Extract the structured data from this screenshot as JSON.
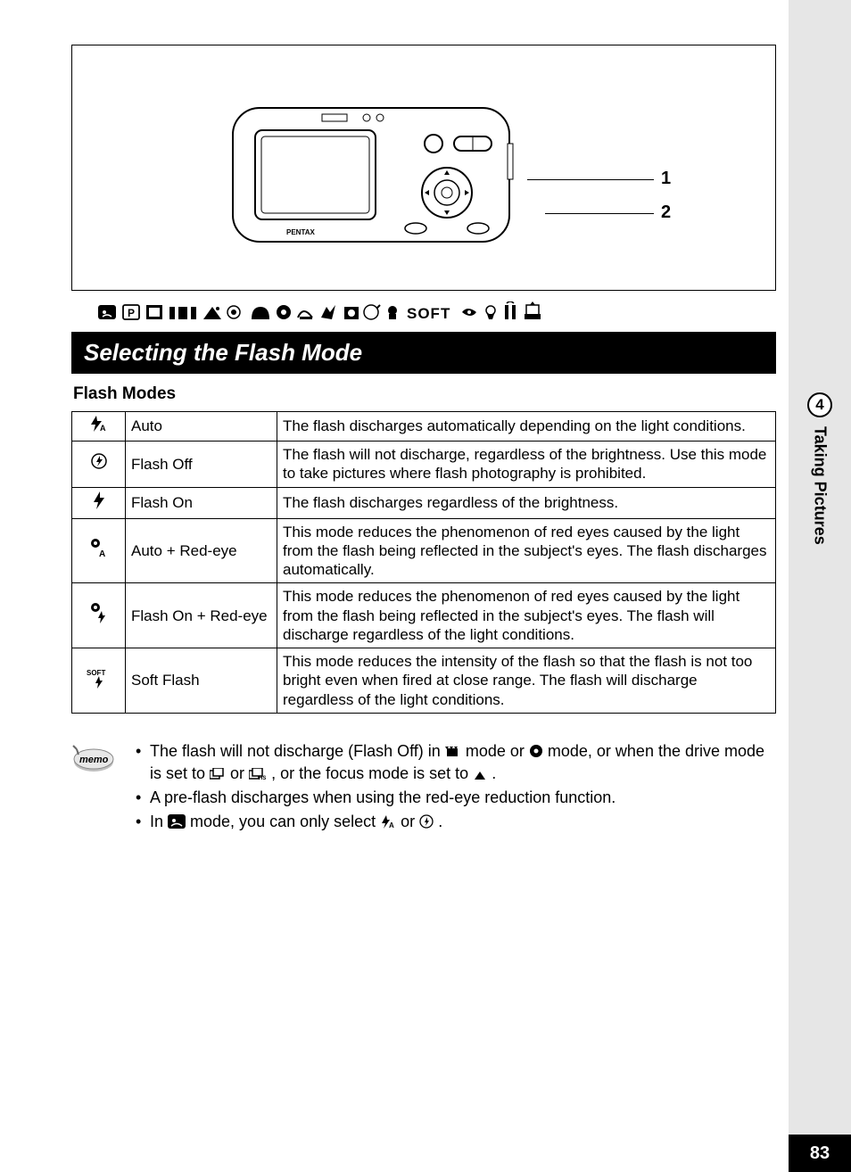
{
  "diagram": {
    "callouts": [
      "1",
      "2"
    ],
    "brand": "PENTAX"
  },
  "mode_icons_row": {
    "soft_label": "SOFT"
  },
  "section_heading": "Selecting the Flash Mode",
  "subheading": "Flash Modes",
  "flash_table": [
    {
      "icon": "flash-auto",
      "name": "Auto",
      "desc": "The flash discharges automatically depending on the light conditions."
    },
    {
      "icon": "flash-off",
      "name": "Flash Off",
      "desc": "The flash will not discharge, regardless of the brightness. Use this mode to take pictures where flash photography is prohibited."
    },
    {
      "icon": "flash-on",
      "name": "Flash On",
      "desc": "The flash discharges regardless of the brightness."
    },
    {
      "icon": "auto-redeye",
      "name": "Auto + Red-eye",
      "desc": "This mode reduces the phenomenon of red eyes caused by the light from the flash being reflected in the subject's eyes. The flash discharges automatically."
    },
    {
      "icon": "flashon-redeye",
      "name": "Flash On + Red-eye",
      "desc": "This mode reduces the phenomenon of red eyes caused by the light from the flash being reflected in the subject's eyes. The flash will discharge regardless of the light conditions."
    },
    {
      "icon": "soft-flash",
      "name": "Soft Flash",
      "desc": "This mode reduces the intensity of the flash so that the flash is not too bright even when fired at close range. The flash will discharge regardless of the light conditions."
    }
  ],
  "memo": {
    "label": "memo",
    "items": [
      {
        "pre": "The flash will not discharge (Flash Off) in ",
        "mid1": " mode or ",
        "mid2": " mode, or when the drive mode is set to ",
        "mid3": " or ",
        "mid4": ", or the focus mode is set to ",
        "post": "."
      },
      {
        "text": "A pre-flash discharges when using the red-eye reduction function."
      },
      {
        "pre": "In ",
        "mid1": " mode, you can only select ",
        "mid2": " or ",
        "post": "."
      }
    ]
  },
  "side": {
    "chapter": "4",
    "title": "Taking Pictures"
  },
  "page_number": "83"
}
